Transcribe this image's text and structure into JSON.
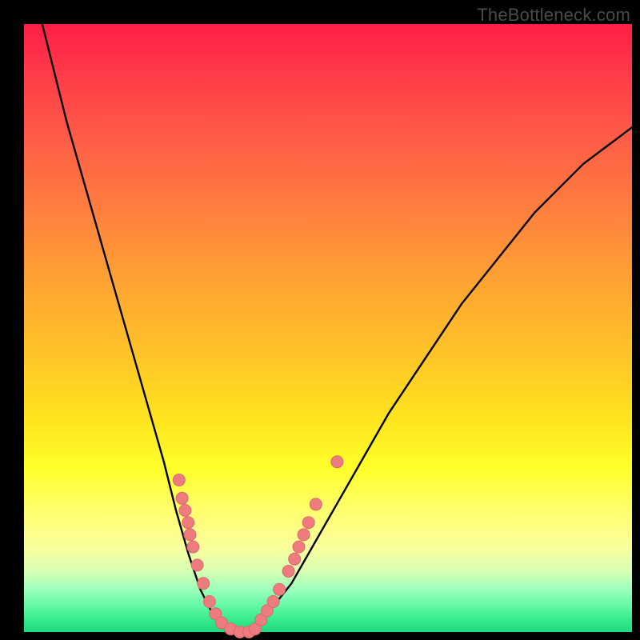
{
  "watermark": "TheBottleneck.com",
  "colors": {
    "curve_stroke": "#000000",
    "dot_fill": "#ee7b7d",
    "dot_stroke": "#d96a6c"
  },
  "chart_data": {
    "type": "line",
    "title": "",
    "xlabel": "",
    "ylabel": "",
    "xlim": [
      0,
      100
    ],
    "ylim": [
      0,
      100
    ],
    "x": [
      3,
      5,
      7,
      9,
      11,
      13,
      15,
      17,
      19,
      21,
      23,
      25,
      27,
      29,
      31,
      33,
      35,
      37,
      40,
      44,
      48,
      52,
      56,
      60,
      64,
      68,
      72,
      76,
      80,
      84,
      88,
      92,
      96,
      100
    ],
    "y": [
      100,
      92,
      84,
      77,
      70,
      63,
      56,
      49,
      42,
      35,
      28,
      20,
      13,
      7,
      3,
      1,
      0,
      0,
      3,
      8,
      15,
      22,
      29,
      36,
      42,
      48,
      54,
      59,
      64,
      69,
      73,
      77,
      80,
      83
    ],
    "series_name": "bottleneck-curve",
    "dots": [
      {
        "x": 25.5,
        "y": 25
      },
      {
        "x": 26.0,
        "y": 22
      },
      {
        "x": 26.5,
        "y": 20
      },
      {
        "x": 27.0,
        "y": 18
      },
      {
        "x": 27.3,
        "y": 16
      },
      {
        "x": 27.8,
        "y": 14
      },
      {
        "x": 28.5,
        "y": 11
      },
      {
        "x": 29.5,
        "y": 8
      },
      {
        "x": 30.5,
        "y": 5
      },
      {
        "x": 31.5,
        "y": 3
      },
      {
        "x": 32.5,
        "y": 1.5
      },
      {
        "x": 34.0,
        "y": 0.5
      },
      {
        "x": 35.5,
        "y": 0
      },
      {
        "x": 37.0,
        "y": 0
      },
      {
        "x": 38.0,
        "y": 0.5
      },
      {
        "x": 39.0,
        "y": 2
      },
      {
        "x": 40.0,
        "y": 3.5
      },
      {
        "x": 41.0,
        "y": 5
      },
      {
        "x": 42.0,
        "y": 7
      },
      {
        "x": 43.5,
        "y": 10
      },
      {
        "x": 44.5,
        "y": 12
      },
      {
        "x": 45.2,
        "y": 14
      },
      {
        "x": 46.0,
        "y": 16
      },
      {
        "x": 46.8,
        "y": 18
      },
      {
        "x": 48.0,
        "y": 21
      },
      {
        "x": 51.5,
        "y": 28
      }
    ]
  }
}
